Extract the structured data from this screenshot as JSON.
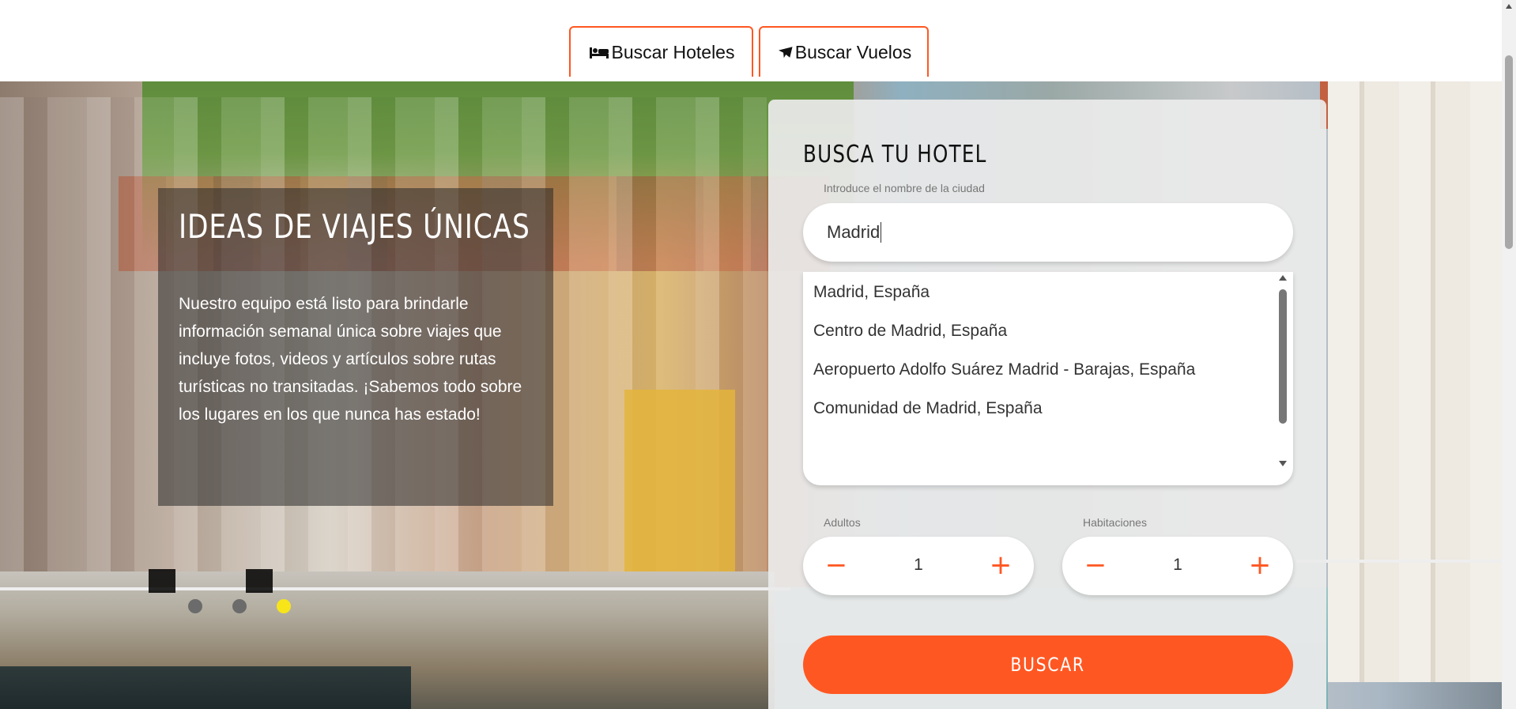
{
  "tabs": [
    {
      "label": "Buscar Hoteles",
      "icon": "bed-icon"
    },
    {
      "label": "Buscar Vuelos",
      "icon": "plane-icon"
    }
  ],
  "hero": {
    "title": "IDEAS DE VIAJES ÚNICAS",
    "text": "Nuestro equipo está listo para brindarle información semanal única sobre viajes que incluye fotos, videos y artículos sobre rutas turísticas no transitadas. ¡Sabemos todo sobre los lugares en los que nunca has estado!",
    "slides": 3,
    "active_slide": 3
  },
  "search": {
    "title": "BUSCA TU HOTEL",
    "city_label": "Introduce el nombre de la ciudad",
    "city_value": "Madrid",
    "suggestions": [
      "Madrid, España",
      "Centro de Madrid, España",
      "Aeropuerto Adolfo Suárez Madrid - Barajas, España",
      "Comunidad de Madrid, España"
    ],
    "adults_label": "Adultos",
    "adults_value": "1",
    "rooms_label": "Habitaciones",
    "rooms_value": "1",
    "button_label": "BUSCAR"
  },
  "colors": {
    "accent": "#ff5722",
    "active_dot": "#f7e51a"
  }
}
